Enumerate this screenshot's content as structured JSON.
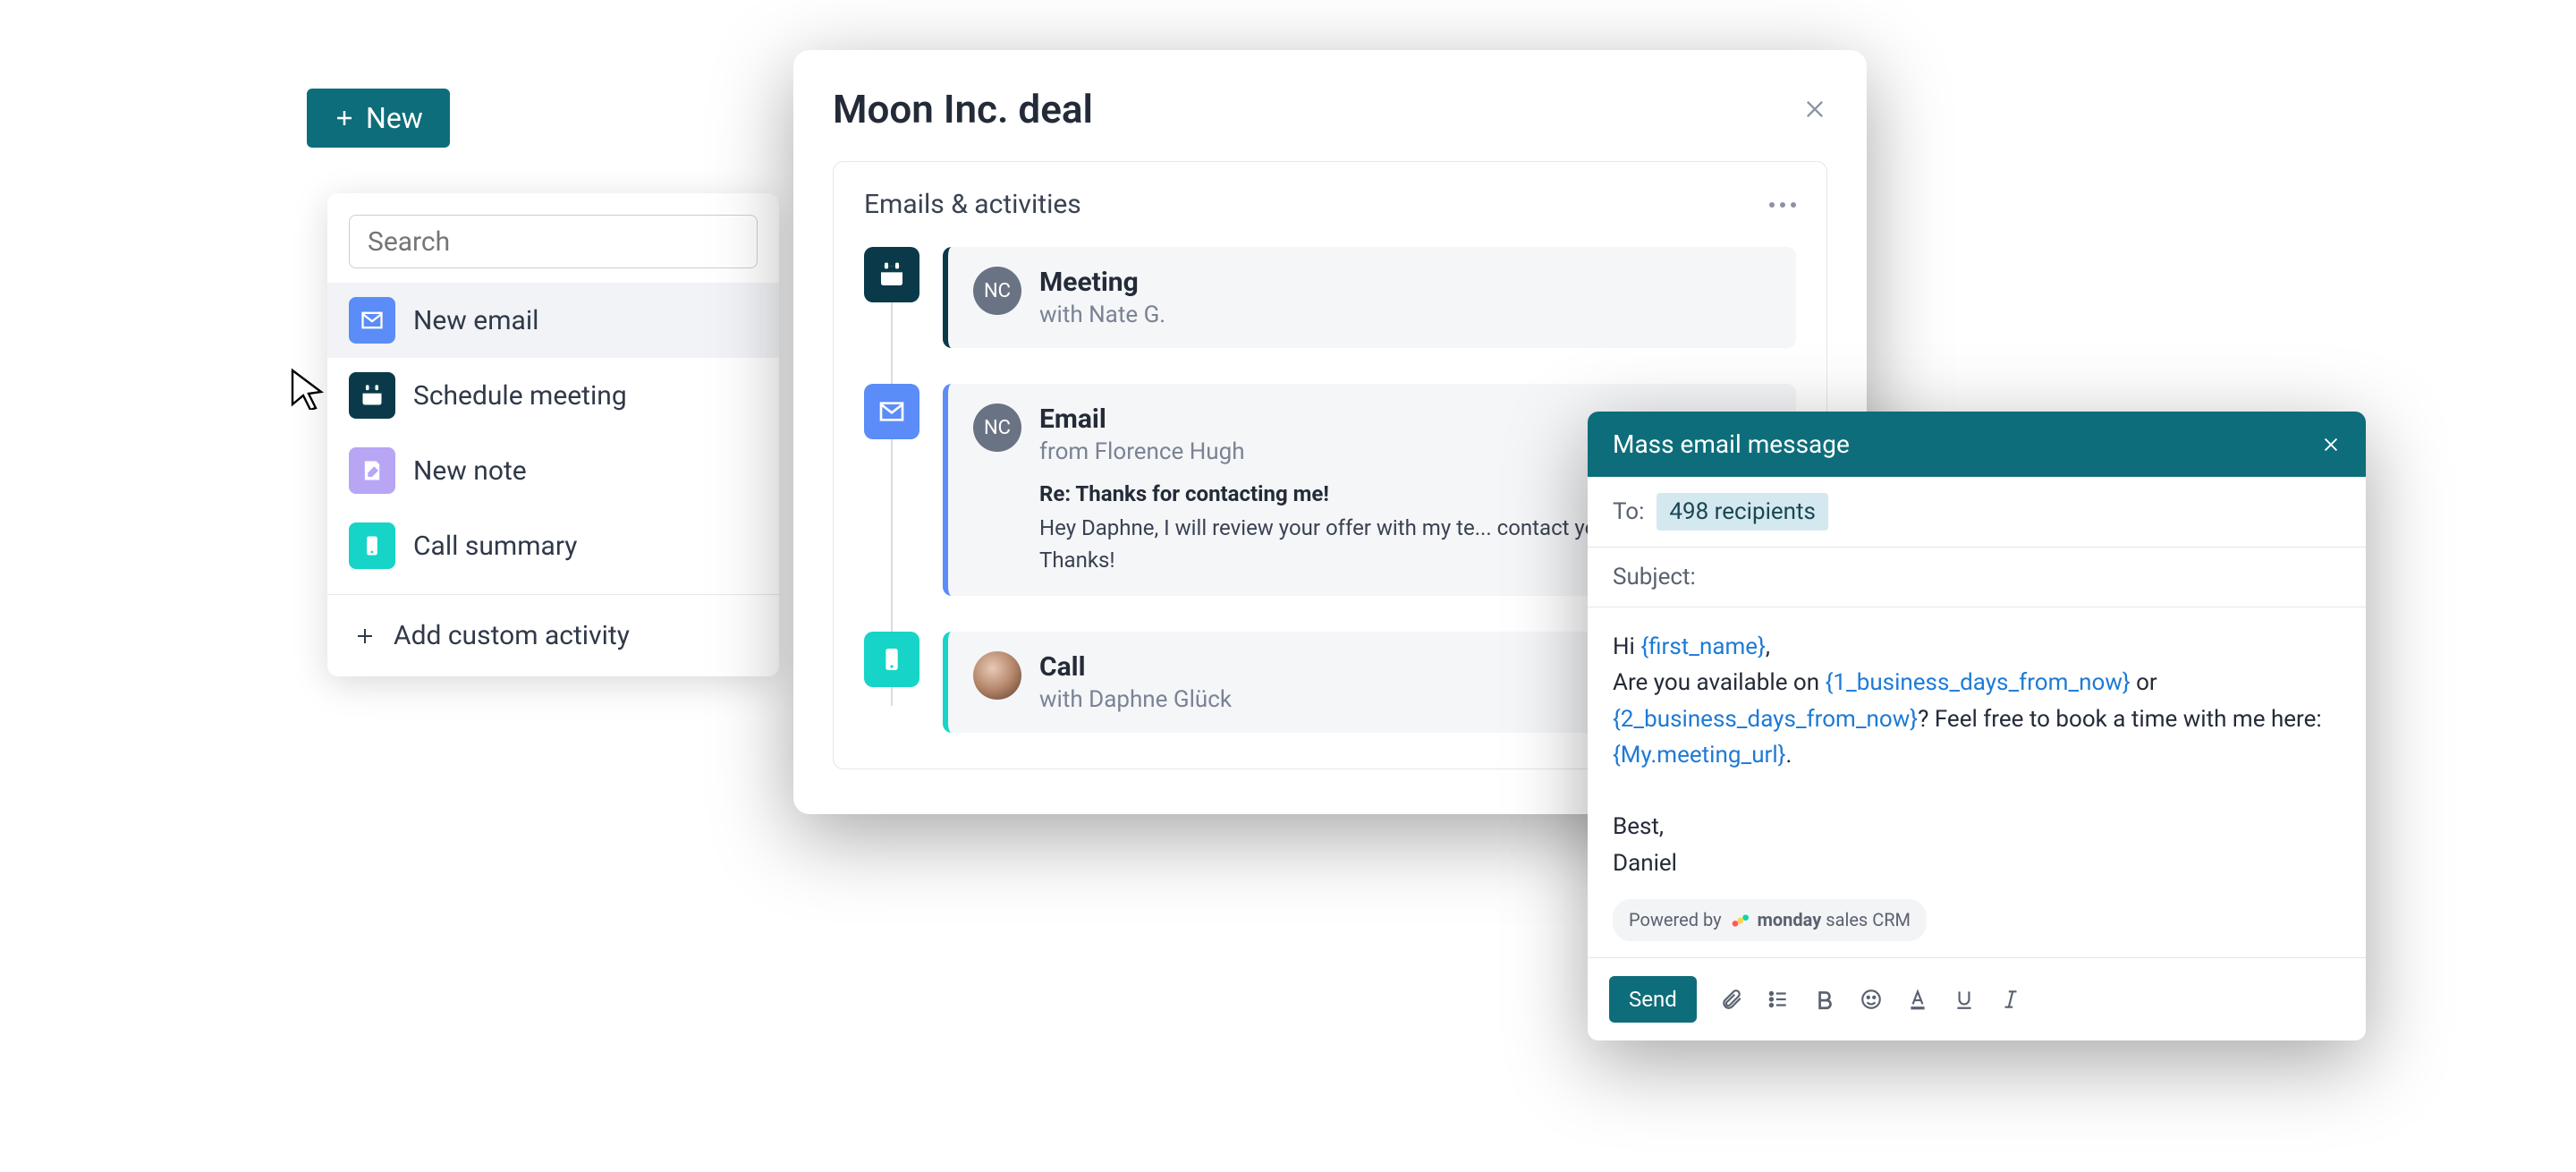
{
  "newButton": {
    "label": "New"
  },
  "activityMenu": {
    "searchPlaceholder": "Search",
    "items": [
      {
        "label": "New email",
        "icon": "email"
      },
      {
        "label": "Schedule meeting",
        "icon": "calendar"
      },
      {
        "label": "New note",
        "icon": "note"
      },
      {
        "label": "Call summary",
        "icon": "call"
      }
    ],
    "addCustom": "Add custom activity"
  },
  "deal": {
    "title": "Moon Inc. deal",
    "sectionTitle": "Emails & activities",
    "timeline": [
      {
        "type": "meeting",
        "title": "Meeting",
        "subtitle": "with Nate G.",
        "avatarInitials": "NC"
      },
      {
        "type": "email",
        "title": "Email",
        "subtitle": "from Florence Hugh",
        "avatarInitials": "NC",
        "subjectLine": "Re: Thanks for contacting me!",
        "preview": "Hey Daphne, I will review your offer with my te... contact you very soon. Thanks!"
      },
      {
        "type": "call",
        "title": "Call",
        "subtitle": "with Daphne Glück"
      }
    ]
  },
  "composer": {
    "title": "Mass email message",
    "toLabel": "To:",
    "recipientsChip": "498 recipients",
    "subjectLabel": "Subject:",
    "body": {
      "greeting": "Hi ",
      "token1": "{first_name}",
      "comma": ",",
      "line2a": "Are you available on ",
      "token2": "{1_business_days_from_now}",
      "line2b": " or ",
      "token3": "{2_business_days_from_now}",
      "line2c": "? Feel free to book a time with me here: ",
      "token4": "{My.meeting_url}",
      "period": ".",
      "signoff1": "Best,",
      "signoff2": "Daniel"
    },
    "poweredBy": {
      "prefix": "Powered by",
      "brand1": "monday",
      "brand2": "sales CRM"
    },
    "sendLabel": "Send"
  }
}
